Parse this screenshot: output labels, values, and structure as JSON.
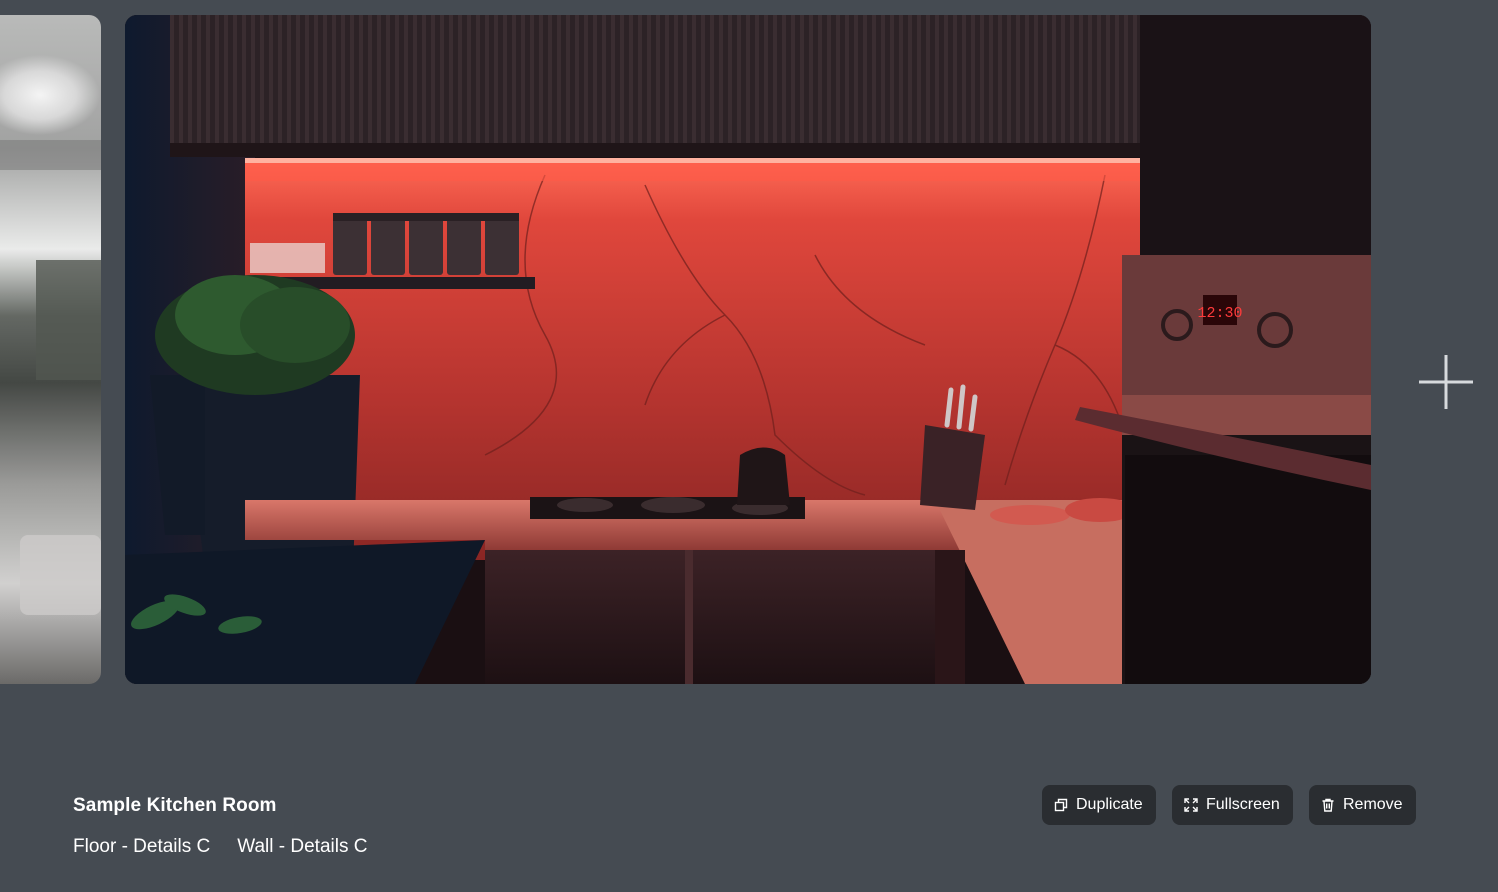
{
  "room": {
    "title": "Sample Kitchen Room",
    "floor": "Floor - Details C",
    "wall": "Wall - Details C"
  },
  "actions": {
    "duplicate": "Duplicate",
    "fullscreen": "Fullscreen",
    "remove": "Remove"
  },
  "oven_display": "12:30",
  "colors": {
    "background": "#454b52",
    "button_bg": "#2a2d31",
    "accent_light": "#ff4a3d"
  }
}
